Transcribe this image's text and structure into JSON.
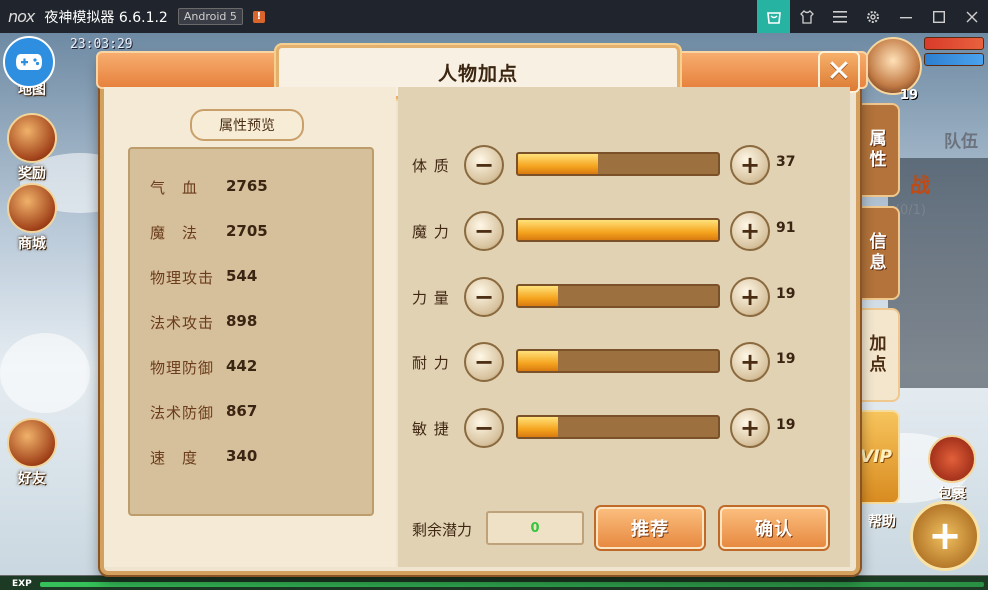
{
  "titlebar": {
    "logo": "nox",
    "title": "夜神模拟器 6.6.1.2",
    "android": "Android 5",
    "warn": "!"
  },
  "game": {
    "clock": "23:03:29",
    "left_menu": [
      "地图",
      "奖励",
      "商城",
      "好友"
    ],
    "avatar_level": "19",
    "team_label": "队伍",
    "quest_text": "战",
    "quest_count": "(0/1)",
    "bottom_right": [
      "包裹",
      "帮助"
    ],
    "exp_label": "EXP"
  },
  "dialog": {
    "title": "人物加点",
    "close_glyph": "✕",
    "attr_preview_title": "属性预览",
    "attributes": [
      {
        "name": "气　血",
        "value": "2765"
      },
      {
        "name": "魔　法",
        "value": "2705"
      },
      {
        "name": "物理攻击",
        "value": "544"
      },
      {
        "name": "法术攻击",
        "value": "898"
      },
      {
        "name": "物理防御",
        "value": "442"
      },
      {
        "name": "法术防御",
        "value": "867"
      },
      {
        "name": "速　度",
        "value": "340"
      }
    ],
    "stats": [
      {
        "label": "体 质",
        "value": "37",
        "fill": 0.4
      },
      {
        "label": "魔 力",
        "value": "91",
        "fill": 1.0
      },
      {
        "label": "力 量",
        "value": "19",
        "fill": 0.2
      },
      {
        "label": "耐 力",
        "value": "19",
        "fill": 0.2
      },
      {
        "label": "敏 捷",
        "value": "19",
        "fill": 0.2
      }
    ],
    "minus_glyph": "−",
    "plus_glyph": "+",
    "remain_label": "剩余潜力",
    "remain_value": "0",
    "recommend_label": "推荐",
    "confirm_label": "确认"
  },
  "side_tabs": {
    "attributes": "属性",
    "info": "信息",
    "add_points": "加点",
    "vip": "VIP"
  }
}
